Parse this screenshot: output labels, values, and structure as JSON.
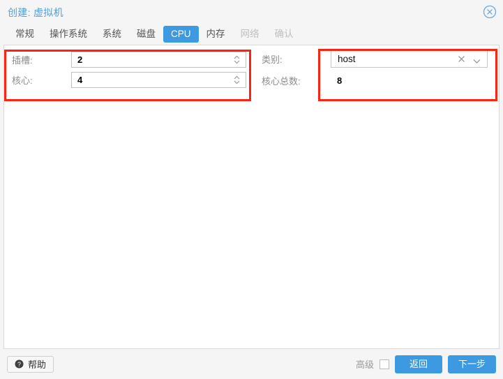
{
  "window": {
    "title": "创建: 虚拟机",
    "close_icon": "close-circle-icon",
    "accent_color": "#3d9ae0",
    "title_color": "#5b9bd5",
    "annotation_color": "#fa2414"
  },
  "tabs": [
    {
      "label": "常规",
      "state": "enabled"
    },
    {
      "label": "操作系统",
      "state": "enabled"
    },
    {
      "label": "系统",
      "state": "enabled"
    },
    {
      "label": "磁盘",
      "state": "enabled"
    },
    {
      "label": "CPU",
      "state": "active"
    },
    {
      "label": "内存",
      "state": "enabled"
    },
    {
      "label": "网络",
      "state": "disabled"
    },
    {
      "label": "确认",
      "state": "disabled"
    }
  ],
  "form": {
    "left": {
      "sockets": {
        "label": "插槽:",
        "value": "2",
        "spinner_icon": "spinner-arrows-icon"
      },
      "cores": {
        "label": "核心:",
        "value": "4",
        "spinner_icon": "spinner-arrows-icon"
      }
    },
    "right": {
      "type": {
        "label": "类别:",
        "value": "host",
        "placeholder": "host",
        "clear_icon": "clear-x-icon",
        "chevron_icon": "chevron-down-icon"
      },
      "total_cores": {
        "label": "核心总数:",
        "value": "8"
      }
    }
  },
  "footer": {
    "help_label": "帮助",
    "help_icon": "question-circle-icon",
    "advanced_label": "高级",
    "advanced_checked": false,
    "back_label": "返回",
    "next_label": "下一步"
  }
}
